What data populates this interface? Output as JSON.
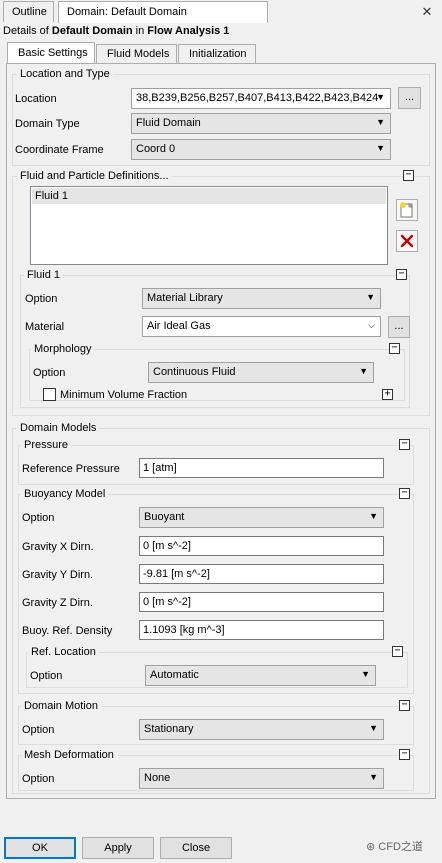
{
  "tabs": {
    "outline": "Outline",
    "domain": "Domain: Default Domain"
  },
  "details": {
    "prefix": "Details of ",
    "object": "Default Domain",
    "mid": " in ",
    "analysis": "Flow Analysis 1"
  },
  "subtabs": {
    "basic": "Basic Settings",
    "fluid_models": "Fluid Models",
    "initialization": "Initialization"
  },
  "location_type": {
    "title": "Location and Type",
    "location_label": "Location",
    "location_value": "38,B239,B256,B257,B407,B413,B422,B423,B424",
    "domain_type_label": "Domain Type",
    "domain_type_value": "Fluid Domain",
    "coord_label": "Coordinate Frame",
    "coord_value": "Coord 0",
    "ellipsis": "..."
  },
  "fluid_defs": {
    "title": "Fluid and Particle Definitions...",
    "items": [
      "Fluid 1"
    ]
  },
  "fluid1": {
    "title": "Fluid 1",
    "option_label": "Option",
    "option_value": "Material Library",
    "material_label": "Material",
    "material_value": "Air Ideal Gas",
    "ellipsis": "...",
    "morph_title": "Morphology",
    "morph_option_label": "Option",
    "morph_option_value": "Continuous Fluid",
    "min_vol_frac": "Minimum Volume Fraction"
  },
  "domain_models": {
    "title": "Domain Models",
    "pressure_title": "Pressure",
    "ref_pressure_label": "Reference Pressure",
    "ref_pressure_value": "1 [atm]",
    "buoyancy_title": "Buoyancy Model",
    "buoy_option_label": "Option",
    "buoy_option_value": "Buoyant",
    "gx_label": "Gravity X Dirn.",
    "gx_value": "0 [m s^-2]",
    "gy_label": "Gravity Y Dirn.",
    "gy_value": "-9.81 [m s^-2]",
    "gz_label": "Gravity Z Dirn.",
    "gz_value": "0 [m s^-2]",
    "density_label": "Buoy. Ref. Density",
    "density_value": "1.1093 [kg m^-3]",
    "ref_loc_title": "Ref. Location",
    "ref_loc_option_label": "Option",
    "ref_loc_option_value": "Automatic",
    "motion_title": "Domain Motion",
    "motion_option_label": "Option",
    "motion_option_value": "Stationary",
    "mesh_title": "Mesh Deformation",
    "mesh_option_label": "Option",
    "mesh_option_value": "None"
  },
  "buttons": {
    "ok": "OK",
    "apply": "Apply",
    "close": "Close"
  },
  "watermark": "CFD之道",
  "colors": {
    "accent": "#0078d7",
    "delete_red": "#c00000"
  }
}
